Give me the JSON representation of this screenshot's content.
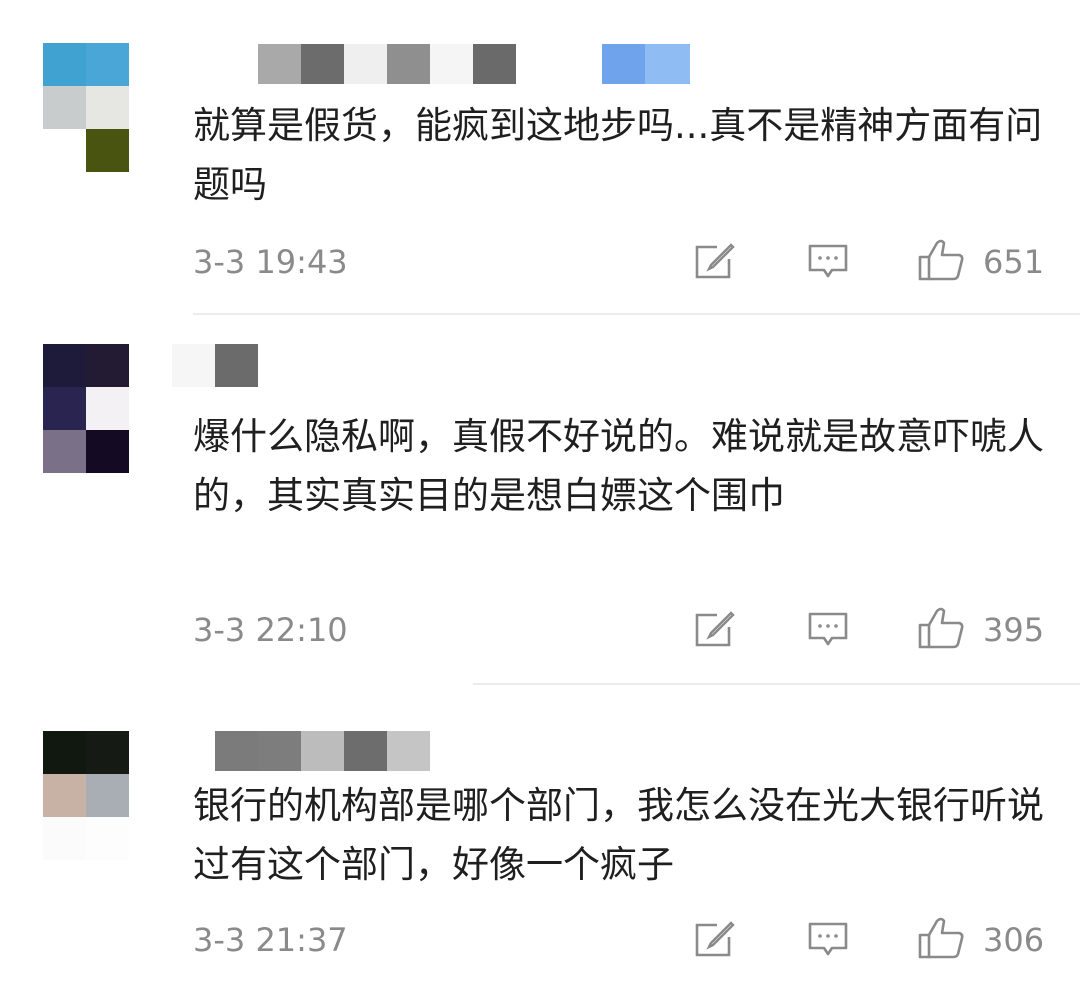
{
  "comments": [
    {
      "text": "就算是假货，能疯到这地步吗...真不是精神方面有问题吗",
      "time": "3-3 19:43",
      "likes": "651"
    },
    {
      "text": "爆什么隐私啊，真假不好说的。难说就是故意吓唬人的，其实真实目的是想白嫖这个围巾",
      "time": "3-3 22:10",
      "likes": "395"
    },
    {
      "text": "银行的机构部是哪个部门，我怎么没在光大银行听说过有这个部门，好像一个疯子",
      "time": "3-3 21:37",
      "likes": "306"
    }
  ],
  "icons": {
    "edit": "edit-icon",
    "reply": "comment-icon",
    "like": "thumbs-up-icon"
  },
  "colors": {
    "text": "#1f1f1f",
    "meta": "#8a8a8a",
    "divider": "#ececec"
  }
}
